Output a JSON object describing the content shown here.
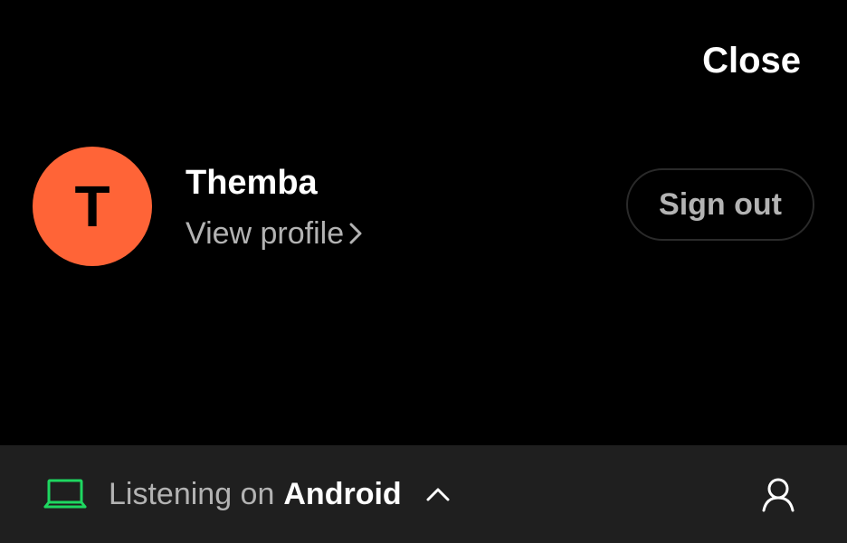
{
  "header": {
    "close_label": "Close"
  },
  "profile": {
    "avatar_initial": "T",
    "avatar_color": "#ff6437",
    "name": "Themba",
    "view_profile_label": "View profile",
    "sign_out_label": "Sign out"
  },
  "bottom_bar": {
    "listening_prefix": "Listening on",
    "device_name": "Android",
    "device_icon": "laptop-icon",
    "accent_color": "#1ed760",
    "expand_icon": "chevron-up-icon",
    "account_icon": "user-icon"
  }
}
